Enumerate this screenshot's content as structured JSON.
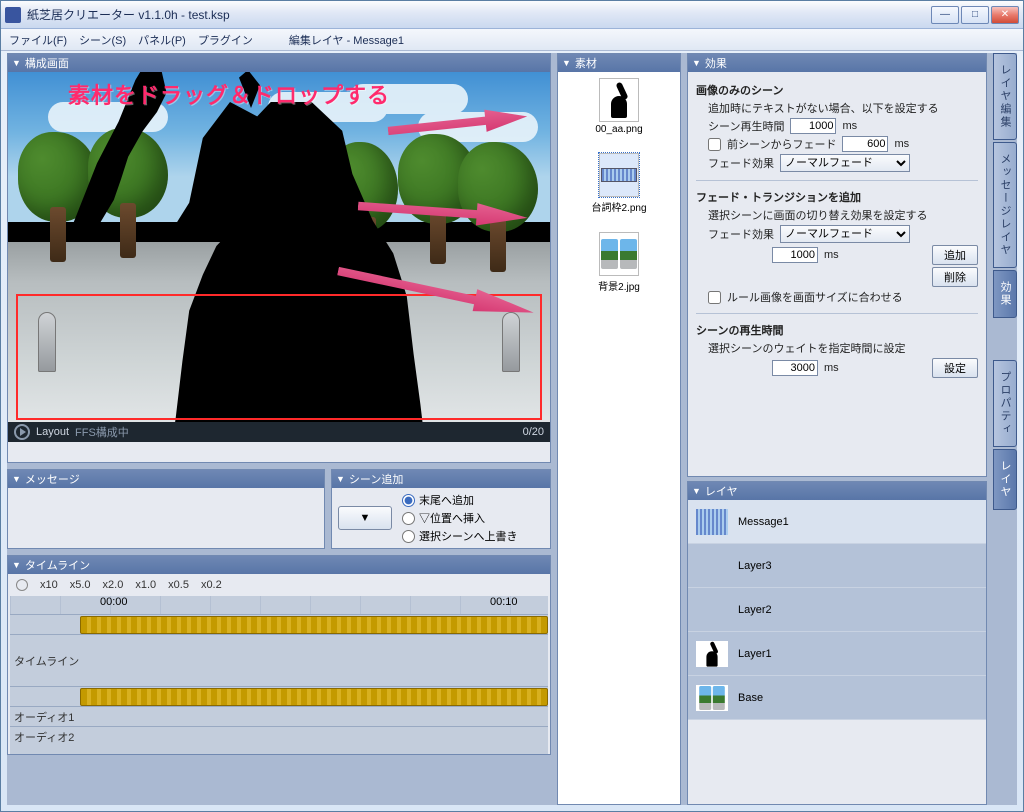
{
  "window": {
    "title": "紙芝居クリエーター v1.1.0h - test.ksp"
  },
  "menu": {
    "file": "ファイル(F)",
    "scene": "シーン(S)",
    "panel": "パネル(P)",
    "plugin": "プラグイン",
    "editLayer": "編集レイヤ - Message1"
  },
  "panels": {
    "preview": "構成画面",
    "assets": "素材",
    "effects": "効果",
    "message": "メッセージ",
    "sceneAdd": "シーン追加",
    "timeline": "タイムライン",
    "layers": "レイヤ"
  },
  "overlay": {
    "text": "素材をドラッグ＆ドロップする"
  },
  "playbar": {
    "layout": "Layout",
    "status": "FFS構成中",
    "counter": "0/20"
  },
  "sceneAdd": {
    "button": "▼",
    "opt1": "末尾へ追加",
    "opt2": "▽位置へ挿入",
    "opt3": "選択シーンへ上書き"
  },
  "timeline": {
    "zooms": [
      "x10",
      "x5.0",
      "x2.0",
      "x1.0",
      "x0.5",
      "x0.2"
    ],
    "mark1": "00:00",
    "mark2": "00:10",
    "rowTimeline": "タイムライン",
    "rowAudio1": "オーディオ1",
    "rowAudio2": "オーディオ2"
  },
  "assets": {
    "items": [
      {
        "name": "00_aa.png",
        "kind": "sil"
      },
      {
        "name": "台詞枠2.png",
        "kind": "bar"
      },
      {
        "name": "背景2.jpg",
        "kind": "bg"
      }
    ]
  },
  "effects": {
    "s1_title": "画像のみのシーン",
    "s1_desc": "追加時にテキストがない場合、以下を設定する",
    "s1_play_label": "シーン再生時間",
    "s1_play_ms": "1000",
    "s1_fadeprev_label": "前シーンからフェード",
    "s1_fadeprev_ms": "600",
    "s1_effect_label": "フェード効果",
    "s1_effect_opt": "ノーマルフェード",
    "ms": "ms",
    "s2_title": "フェード・トランジションを追加",
    "s2_desc": "選択シーンに画面の切り替え効果を設定する",
    "s2_effect_label": "フェード効果",
    "s2_effect_opt": "ノーマルフェード",
    "s2_ms": "1000",
    "s2_add": "追加",
    "s2_del": "削除",
    "s2_rule": "ルール画像を画面サイズに合わせる",
    "s3_title": "シーンの再生時間",
    "s3_desc": "選択シーンのウェイトを指定時間に設定",
    "s3_ms": "3000",
    "s3_set": "設定"
  },
  "layers": {
    "items": [
      {
        "name": "Message1",
        "thumb": "msg"
      },
      {
        "name": "Layer3",
        "thumb": "blank"
      },
      {
        "name": "Layer2",
        "thumb": "blank"
      },
      {
        "name": "Layer1",
        "thumb": "sil"
      },
      {
        "name": "Base",
        "thumb": "bg"
      }
    ]
  },
  "sideTabs": {
    "upper": [
      "レイヤ編集",
      "メッセージレイヤ",
      "効果"
    ],
    "lower": [
      "プロパティ",
      "レイヤ"
    ]
  }
}
